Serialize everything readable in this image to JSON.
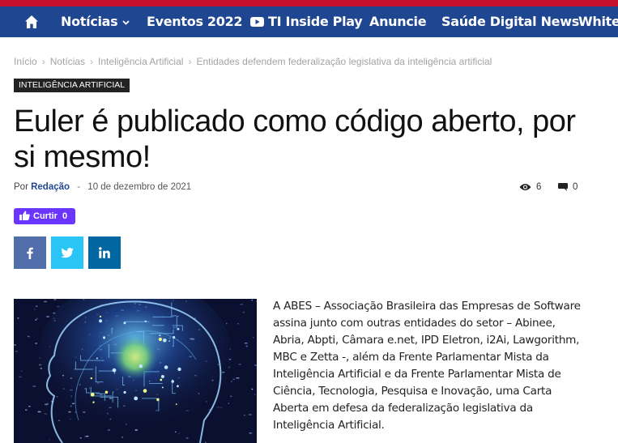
{
  "nav": {
    "items": [
      {
        "label": "Notícias",
        "has_dropdown": true
      },
      {
        "label": "Eventos 2022"
      },
      {
        "label": "TI Inside Play",
        "icon": "youtube-icon"
      },
      {
        "label": "Anuncie"
      },
      {
        "label": "Saúde Digital News"
      },
      {
        "label": "White"
      }
    ]
  },
  "breadcrumb": [
    "Início",
    "Notícias",
    "Inteligência Artificial",
    "Entidades defendem federalização legislativa da inteligência artificial"
  ],
  "category": "INTELIGÊNCIA ARTIFICIAL",
  "title": "Euler é publicado como código aberto, por si mesmo!",
  "meta": {
    "by": "Por",
    "author": "Redação",
    "separator": "-",
    "date": "10 de dezembro de 2021",
    "views": "6",
    "comments": "0"
  },
  "like": {
    "label": "Curtir",
    "count": "0"
  },
  "share": [
    {
      "network": "facebook",
      "icon": "facebook-icon",
      "color": "#516eab"
    },
    {
      "network": "twitter",
      "icon": "twitter-icon",
      "color": "#29c5f6"
    },
    {
      "network": "linkedin",
      "icon": "linkedin-icon",
      "color": "#0266a0"
    }
  ],
  "article": {
    "lead": "A ABES – Associação Brasileira das Empresas de Software assina junto com outras entidades do setor – Abinee, Abria, Abpti, Câmara e.net, IPD Eletron, i2Ai, Lawgorithm, MBC e Zetta -, além da Frente Parlamentar Mista da Inteligência Artificial e da Frente Parlamentar Mista de Ciência, Tecnologia, Pesquisa e Inovação, uma Carta Aberta em defesa da federalização legislativa da Inteligência Artificial."
  },
  "colors": {
    "topline": "#c8102e",
    "navbar": "#1f4690",
    "like": "#6a35ff"
  }
}
